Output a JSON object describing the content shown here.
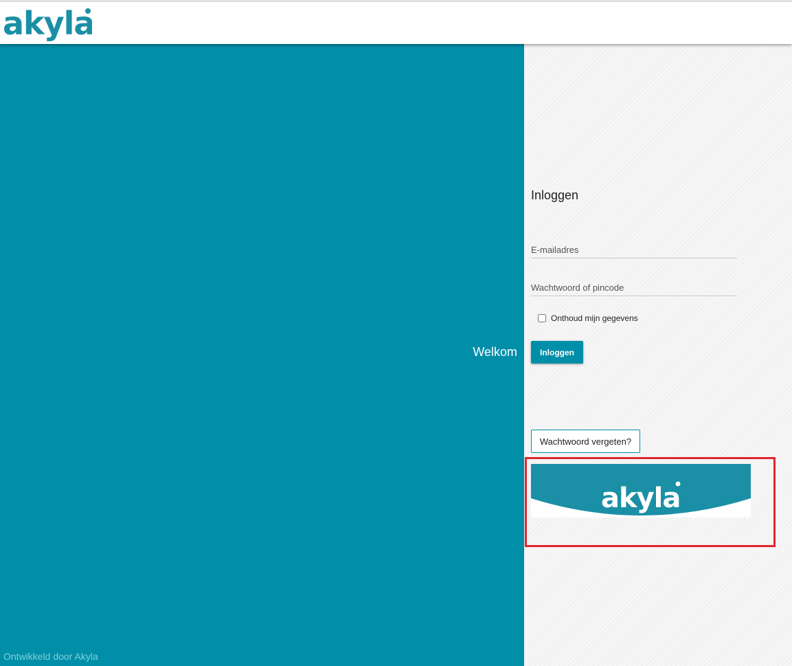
{
  "header": {
    "logo_text": "akyla"
  },
  "left_panel": {
    "welcome": "Welkom",
    "footer_credit": "Ontwikkeld door Akyla"
  },
  "login_form": {
    "title": "Inloggen",
    "email_placeholder": "E-mailadres",
    "password_placeholder": "Wachtwoord of pincode",
    "remember_label": "Onthoud mijn gegevens",
    "remember_checked": false,
    "submit_label": "Inloggen",
    "forgot_label": "Wachtwoord vergeten?"
  },
  "banner": {
    "logo_text": "akyla"
  },
  "colors": {
    "brand": "#008ea8",
    "highlight": "#e0262b",
    "right_panel_bg": "#f6f6f6"
  }
}
